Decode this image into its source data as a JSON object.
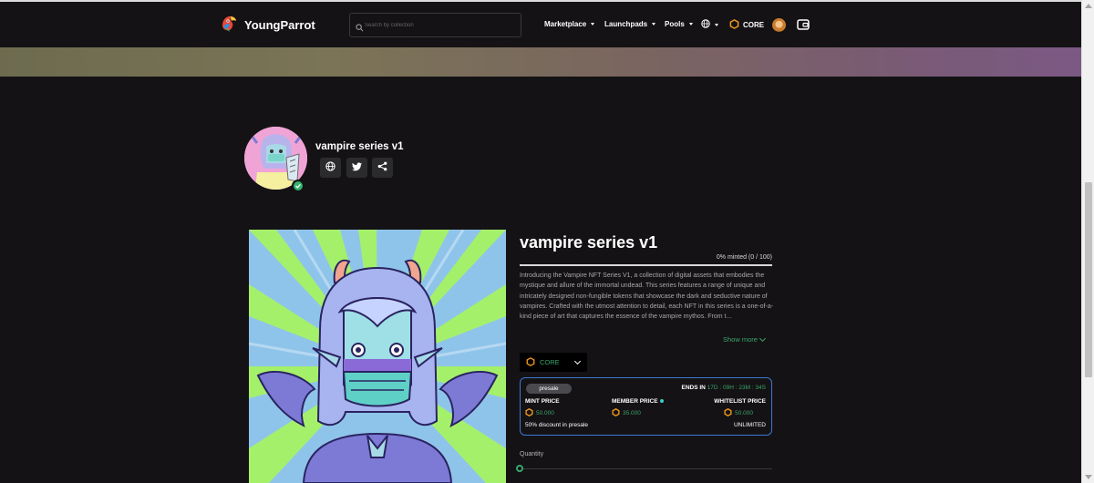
{
  "nav": {
    "brand": "YoungParrot",
    "search_placeholder": "Search by collection",
    "items": [
      {
        "label": "Marketplace"
      },
      {
        "label": "Launchpads"
      },
      {
        "label": "Pools"
      }
    ],
    "chain": "CORE",
    "icons": [
      "parrot-logo-icon",
      "search-icon",
      "globe-icon",
      "core-hex-icon",
      "avatar",
      "wallet-icon"
    ]
  },
  "colors": {
    "background": "#141214",
    "accent_green": "#3aa56d",
    "mint_border": "#3b79d6",
    "banner_left": "#6d6b4f",
    "banner_right": "#7b5984"
  },
  "profile": {
    "title": "vampire series v1",
    "socials": [
      "globe-icon",
      "twitter-icon",
      "share-icon"
    ]
  },
  "detail": {
    "title": "vampire series v1",
    "minted_text": "0% minted (0 / 100)",
    "minted_fraction": 0,
    "description": "Introducing the Vampire NFT Series V1, a collection of digital assets that embodies the mystique and allure of the immortal undead. This series features a range of unique and intricately designed non-fungible tokens that showcase the dark and seductive nature of vampires. Crafted with the utmost attention to detail, each NFT in this series is a one-of-a-kind piece of art that captures the essence of the vampire mythos. From t...",
    "show_more": "Show more",
    "chain_select": "CORE"
  },
  "mint": {
    "phase": "presale",
    "ends_label": "ENDS IN",
    "countdown": "17D : 09H : 23M : 34S",
    "mint_label": "MINT PRICE",
    "mint_value": "50.000",
    "member_label": "MEMBER PRICE",
    "member_value": "35.000",
    "whitelist_label": "WHITELIST PRICE",
    "whitelist_value": "50.000",
    "discount": "50% discount in presale",
    "limit": "UNLIMITED"
  },
  "quantity": {
    "label": "Quantity"
  }
}
